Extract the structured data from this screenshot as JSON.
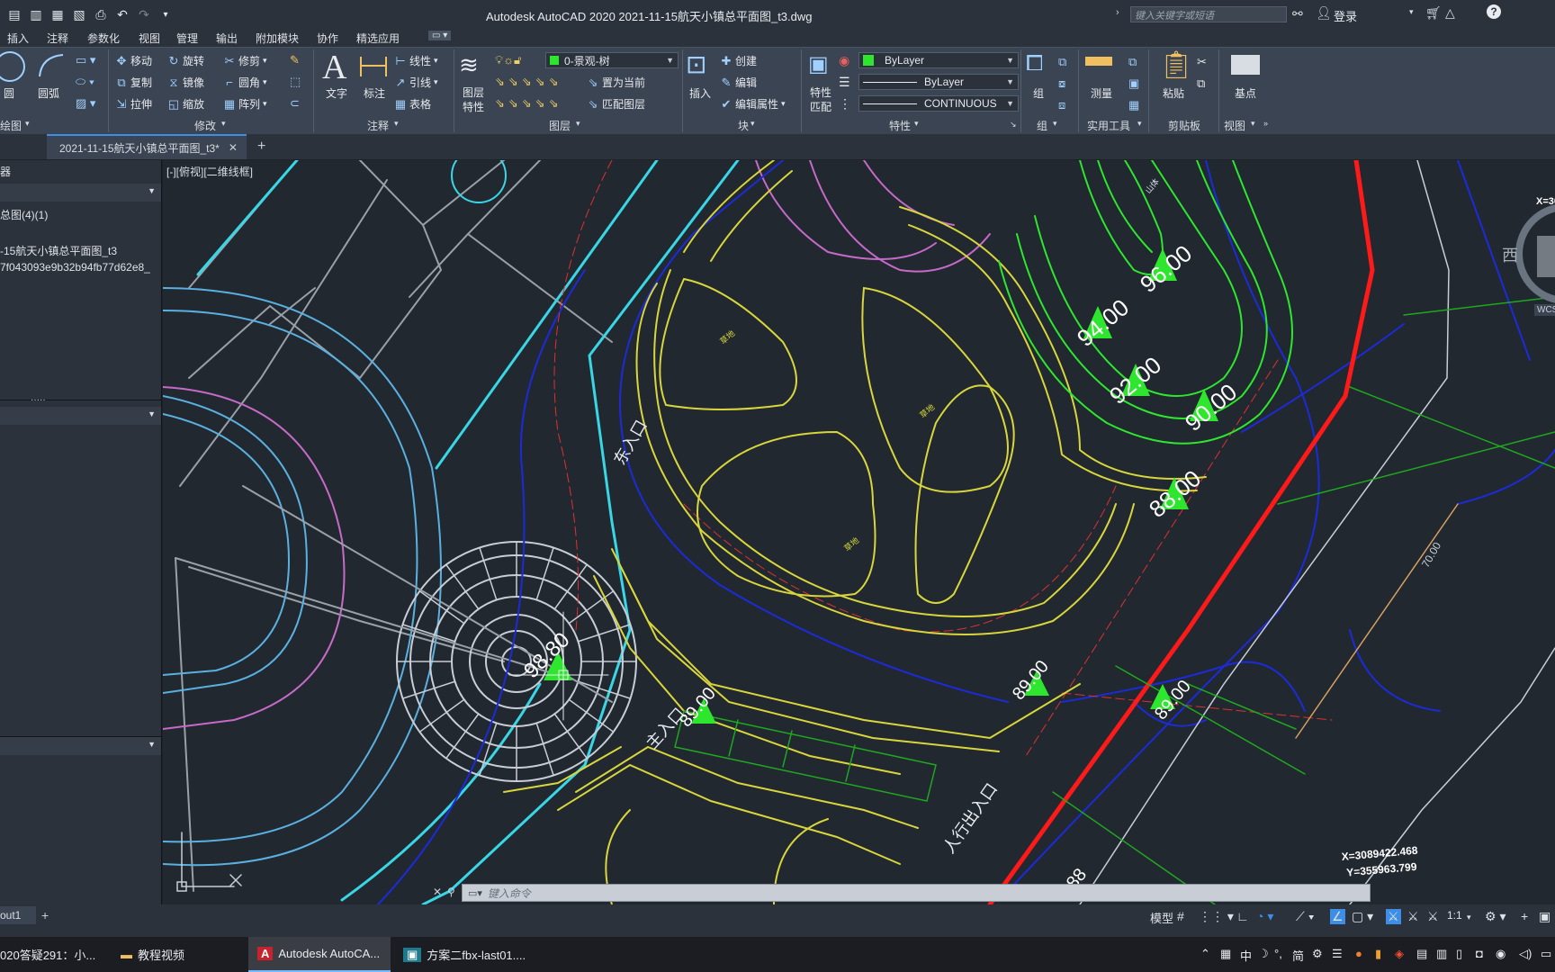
{
  "app": {
    "title": "Autodesk AutoCAD 2020    2021-11-15航天小镇总平面图_t3.dwg",
    "search_placeholder": "键入关键字或短语",
    "login_label": "登录"
  },
  "menu": [
    "插入",
    "注释",
    "参数化",
    "视图",
    "管理",
    "输出",
    "附加模块",
    "协作",
    "精选应用"
  ],
  "ribbon": {
    "draw": {
      "circle": "圆",
      "arc": "圆弧",
      "group_label": "绘图"
    },
    "modify": {
      "move": "移动",
      "rotate": "旋转",
      "trim": "修剪",
      "copy": "复制",
      "mirror": "镜像",
      "fillet": "圆角",
      "stretch": "拉伸",
      "scale": "缩放",
      "array": "阵列",
      "group_label": "修改"
    },
    "annotation": {
      "text": "文字",
      "dimension": "标注",
      "linear": "线性",
      "leader": "引线",
      "table": "表格",
      "group_label": "注释"
    },
    "layers": {
      "layer_props": "图层特性",
      "current_layer": "0-景观-树",
      "set_current": "置为当前",
      "match_layer": "匹配图层",
      "group_label": "图层"
    },
    "block": {
      "insert": "插入",
      "create": "创建",
      "edit": "编辑",
      "edit_attr": "编辑属性",
      "group_label": "块"
    },
    "properties": {
      "match": "特性匹配",
      "color": "ByLayer",
      "lineweight": "ByLayer",
      "linetype": "CONTINUOUS",
      "group_label": "特性"
    },
    "groups": {
      "group": "组",
      "group_label": "组"
    },
    "utilities": {
      "measure": "测量",
      "group_label": "实用工具"
    },
    "clipboard": {
      "paste": "粘贴",
      "group_label": "剪贴板"
    },
    "view": {
      "base": "基点",
      "group_label": "视图"
    }
  },
  "doc_tab": {
    "label": "2021-11-15航天小镇总平面图_t3*",
    "new_tab": "+"
  },
  "left_panel": {
    "title": "器",
    "item1": "总图(4)(1)",
    "item2": "-15航天小镇总平面图_t3",
    "item3": "7f043093e9b32b94fb77d62e8_"
  },
  "viewport_label": "[-][俯视][二维线框]",
  "drawing": {
    "labels": {
      "east_entrance": "东入口",
      "main_entrance": "主入口",
      "pedestrian_exit": "人行出入口",
      "elev_96": "96.00",
      "elev_94": "94.00",
      "elev_92": "92.00",
      "elev_90": "90.00",
      "elev_88a": "88.00",
      "elev_88b": "88.00",
      "elev_89a": "89.00",
      "elev_89b": "89.00",
      "elev_89c": "89.00",
      "elev_98": "98.80",
      "contour_70": "70.00",
      "lawn1": "草地",
      "lawn2": "草地",
      "lawn3": "草地",
      "hill": "山体",
      "bottom_num": "88"
    },
    "coords": {
      "x": "X=3089422.468",
      "y": "Y=355963.799"
    },
    "viewcube_west": "西",
    "viewcube_wcs": "WCS",
    "viewcube_x": "X=30"
  },
  "command": {
    "placeholder": "键入命令"
  },
  "layout_tabs": {
    "layout": "out1",
    "add": "+"
  },
  "status": {
    "model": "模型",
    "scale": "1:1"
  },
  "taskbar": {
    "item1": "020答疑291：小...",
    "item2": "教程视频",
    "item3": "Autodesk AutoCA...",
    "item4": "方案二fbx-last01....",
    "ime": "中",
    "ime2": "简"
  },
  "colors": {
    "accent": "#3c8ee6",
    "contour_green": "#2ee62e",
    "road_red": "#ff1a1a",
    "path_yellow": "#d8d63c",
    "boundary_cyan": "#39d6e6",
    "magenta": "#d33fd8",
    "blue_line": "#1c2bd8"
  }
}
